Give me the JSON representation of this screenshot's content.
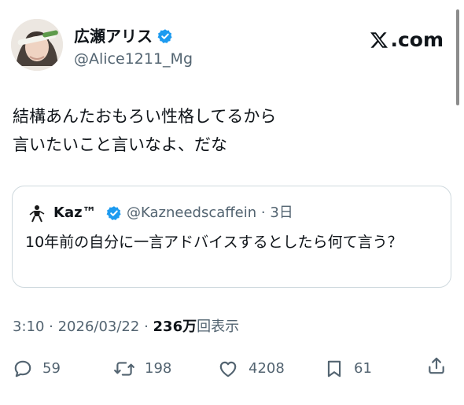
{
  "author": {
    "display_name": "広瀬アリス",
    "handle": "@Alice1211_Mg"
  },
  "brand": {
    "logo_text": ".com",
    "icon": "x-logo-icon"
  },
  "tweet": {
    "text": "結構あんたおもろい性格してるから\n言いたいこと言いなよ、だな"
  },
  "quoted": {
    "display_name": "Kaz™",
    "handle": "@Kazneedscaffein",
    "separator": " · ",
    "time": "3日",
    "text": "10年前の自分に一言アドバイスするとしたら何て言う？"
  },
  "meta": {
    "time": "3:10",
    "separator": " · ",
    "date": "2026/03/22",
    "separator2": " · ",
    "views_number": "236",
    "views_unit": "万",
    "views_label": "回表示"
  },
  "actions": {
    "replies": "59",
    "reposts": "198",
    "likes": "4208",
    "bookmarks": "61"
  },
  "colors": {
    "text": "#0f1419",
    "secondary": "#536471",
    "verified": "#1d9bf0",
    "border": "#cfd9de"
  }
}
